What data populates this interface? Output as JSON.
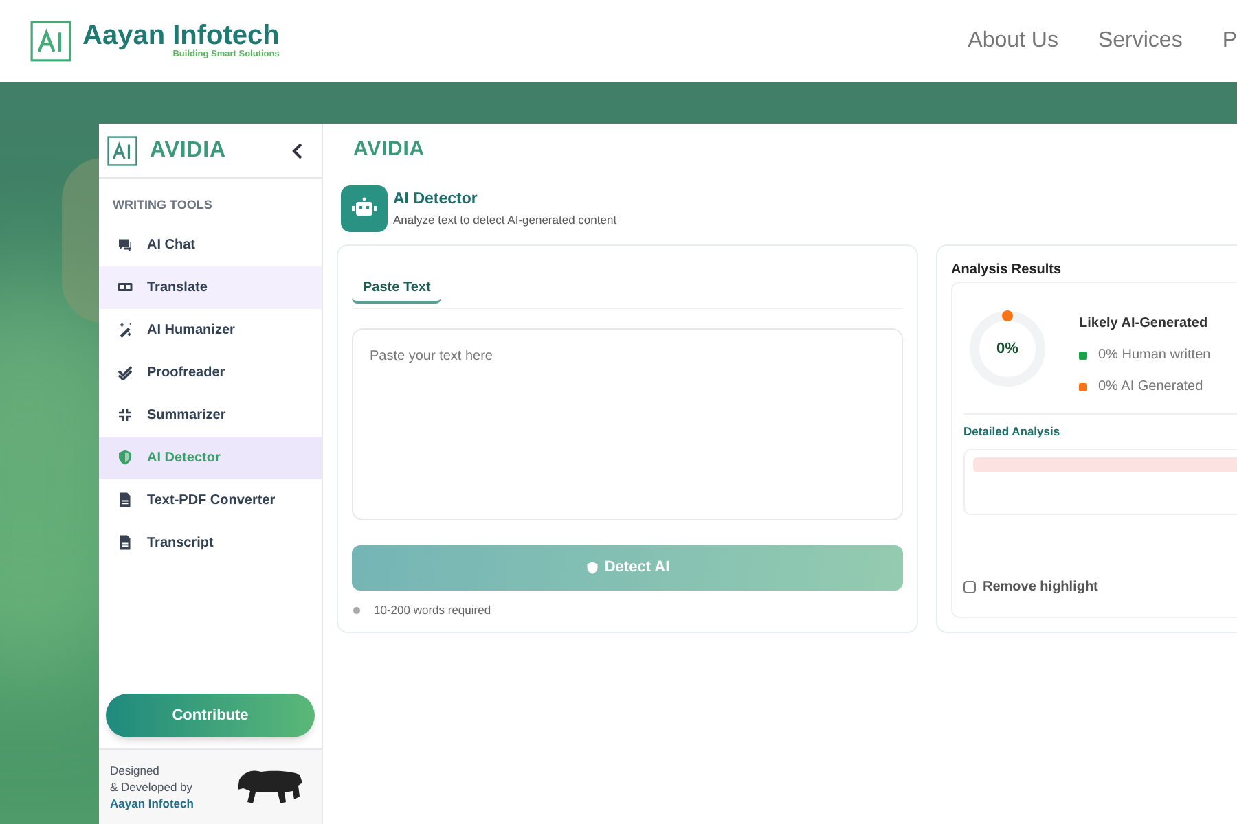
{
  "header": {
    "brand": "Aayan Infotech",
    "tagline": "Building Smart Solutions",
    "nav": [
      "About Us",
      "Services",
      "P"
    ]
  },
  "sidebar": {
    "title": "AVIDIA",
    "section": "WRITING TOOLS",
    "items": [
      {
        "label": "AI Chat",
        "selected": false,
        "hovered": false
      },
      {
        "label": "Translate",
        "selected": false,
        "hovered": true
      },
      {
        "label": "AI Humanizer",
        "selected": false,
        "hovered": false
      },
      {
        "label": "Proofreader",
        "selected": false,
        "hovered": false
      },
      {
        "label": "Summarizer",
        "selected": false,
        "hovered": false
      },
      {
        "label": "AI Detector",
        "selected": true,
        "hovered": false
      },
      {
        "label": "Text-PDF Converter",
        "selected": false,
        "hovered": false
      },
      {
        "label": "Transcript",
        "selected": false,
        "hovered": false
      }
    ],
    "contribute": "Contribute",
    "credit": [
      "Designed",
      "& Developed by"
    ],
    "credit_link": "Aayan Infotech"
  },
  "main": {
    "title": "AVIDIA",
    "tool": {
      "name": "AI Detector",
      "description": "Analyze text to detect AI-generated content"
    },
    "tabs": [
      {
        "label": "Paste Text",
        "selected": true
      }
    ],
    "input": {
      "placeholder": "Paste your text here"
    },
    "detect_button": "Detect AI",
    "hint": "10-200 words required"
  },
  "results": {
    "title": "Analysis Results",
    "gauge": {
      "reading": "0%"
    },
    "verdict": "Likely AI-Generated",
    "legend": [
      {
        "label": "0% Human written",
        "color": "#16a34a"
      },
      {
        "label": "0% AI Generated",
        "color": "#f97316"
      }
    ],
    "detailed_title": "Detailed Analysis",
    "remove_highlight": {
      "label": "Remove highlight",
      "checked": false
    }
  }
}
